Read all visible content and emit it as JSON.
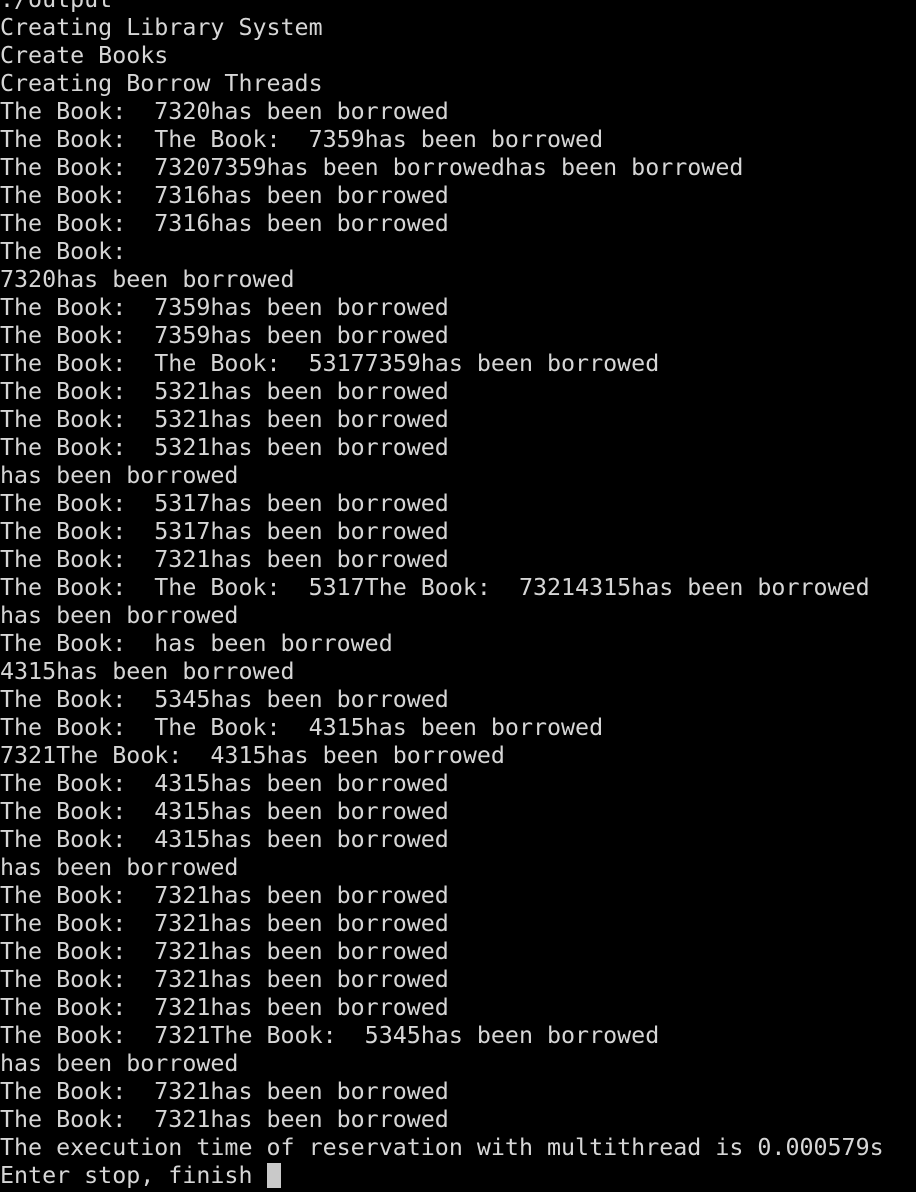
{
  "terminal": {
    "lines": [
      "./output",
      "Creating Library System",
      "Create Books",
      "Creating Borrow Threads",
      "The Book:  7320has been borrowed",
      "The Book:  The Book:  7359has been borrowed",
      "The Book:  73207359has been borrowedhas been borrowed",
      "The Book:  7316has been borrowed",
      "The Book:  7316has been borrowed",
      "The Book:  ",
      "7320has been borrowed",
      "The Book:  7359has been borrowed",
      "The Book:  7359has been borrowed",
      "The Book:  The Book:  53177359has been borrowed",
      "The Book:  5321has been borrowed",
      "The Book:  5321has been borrowed",
      "The Book:  5321has been borrowed",
      "has been borrowed",
      "The Book:  5317has been borrowed",
      "The Book:  5317has been borrowed",
      "The Book:  7321has been borrowed",
      "The Book:  The Book:  5317The Book:  73214315has been borrowed",
      "has been borrowed",
      "The Book:  has been borrowed",
      "4315has been borrowed",
      "The Book:  5345has been borrowed",
      "The Book:  The Book:  4315has been borrowed",
      "7321The Book:  4315has been borrowed",
      "The Book:  4315has been borrowed",
      "The Book:  4315has been borrowed",
      "The Book:  4315has been borrowed",
      "has been borrowed",
      "The Book:  7321has been borrowed",
      "The Book:  7321has been borrowed",
      "The Book:  7321has been borrowed",
      "The Book:  7321has been borrowed",
      "The Book:  7321has been borrowed",
      "The Book:  7321The Book:  5345has been borrowed",
      "has been borrowed",
      "The Book:  7321has been borrowed",
      "The Book:  7321has been borrowed",
      "The execution time of reservation with multithread is 0.000579s"
    ],
    "prompt": "Enter stop, finish "
  },
  "colors": {
    "background": "#000000",
    "text": "#d6d6d6",
    "cursor": "#c9c9c9"
  }
}
